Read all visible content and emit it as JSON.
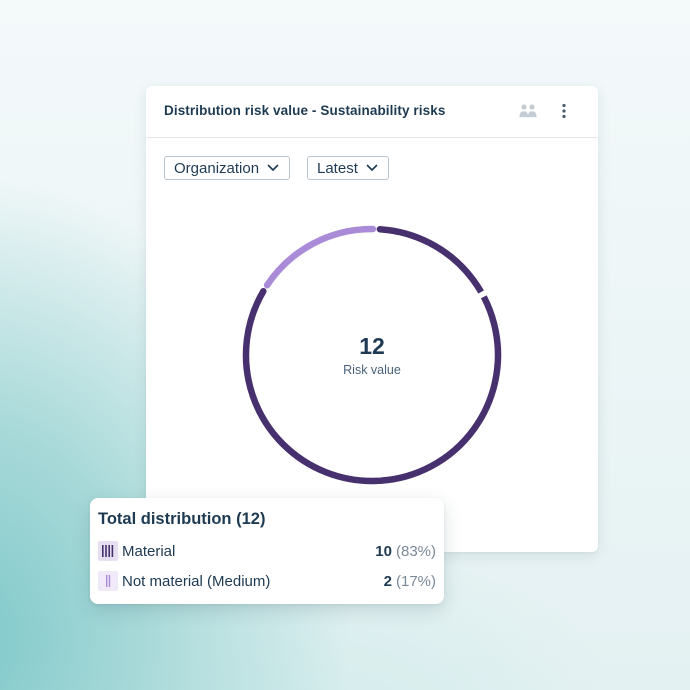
{
  "card": {
    "title": "Distribution risk value - Sustainability risks",
    "people_icon": "people-group-icon",
    "menu_icon": "more-vertical-icon"
  },
  "filters": [
    {
      "label": "Organization",
      "icon": "chevron-down-icon"
    },
    {
      "label": "Latest",
      "icon": "chevron-down-icon"
    }
  ],
  "colors": {
    "material": "#47306e",
    "not_material": "#a98bd8",
    "text": "#1e3a52"
  },
  "chart_data": {
    "type": "pie",
    "center_value": "12",
    "center_label": "Risk value",
    "slices": [
      {
        "label": "Material",
        "value": 10,
        "percent": 83,
        "color": "#47306e"
      },
      {
        "label": "Not material (Medium)",
        "value": 2,
        "percent": 17,
        "color": "#a98bd8"
      }
    ]
  },
  "legend": {
    "title": "Total distribution (12)",
    "items": [
      {
        "label": "Material",
        "count": "10",
        "percent": "(83%)"
      },
      {
        "label": "Not material (Medium)",
        "count": "2",
        "percent": "(17%)"
      }
    ]
  }
}
